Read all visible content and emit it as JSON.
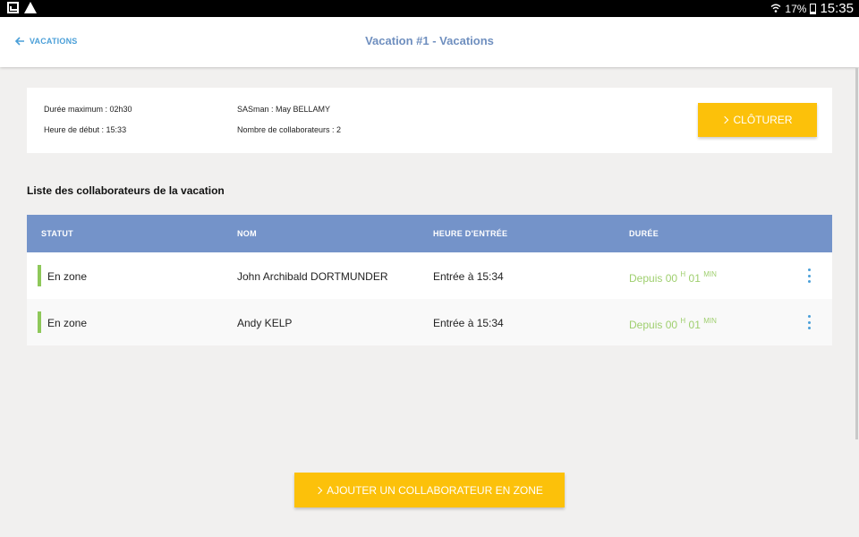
{
  "statusbar": {
    "battery": "17%",
    "time": "15:35"
  },
  "appbar": {
    "back_label": "VACATIONS",
    "title": "Vacation #1 - Vacations"
  },
  "info": {
    "duree_max": "Durée maximum : 02h30",
    "heure_debut": "Heure de début : 15:33",
    "sasman": "SASman : May BELLAMY",
    "nb_collab": "Nombre de collaborateurs : 2",
    "close_label": "CLÔTURER"
  },
  "list_title": "Liste des collaborateurs de la vacation",
  "table": {
    "headers": [
      "STATUT",
      "NOM",
      "HEURE D'ENTRÉE",
      "DURÉE"
    ],
    "rows": [
      {
        "status": "En zone",
        "name": "John Archibald DORTMUNDER",
        "entry": "Entrée à 15:34",
        "dur_prefix": "Depuis 00",
        "dur_h": "H",
        "dur_mid": "01",
        "dur_min": "MIN"
      },
      {
        "status": "En zone",
        "name": "Andy KELP",
        "entry": "Entrée à 15:34",
        "dur_prefix": "Depuis 00",
        "dur_h": "H",
        "dur_mid": "01",
        "dur_min": "MIN"
      }
    ]
  },
  "add_button_label": "AJOUTER UN COLLABORATEUR EN ZONE",
  "colors": {
    "accent": "#fcc10a",
    "header": "#7493c9",
    "link": "#4a9fd8",
    "status_green": "#8ec85a",
    "duration_green": "#9fcf6f"
  }
}
